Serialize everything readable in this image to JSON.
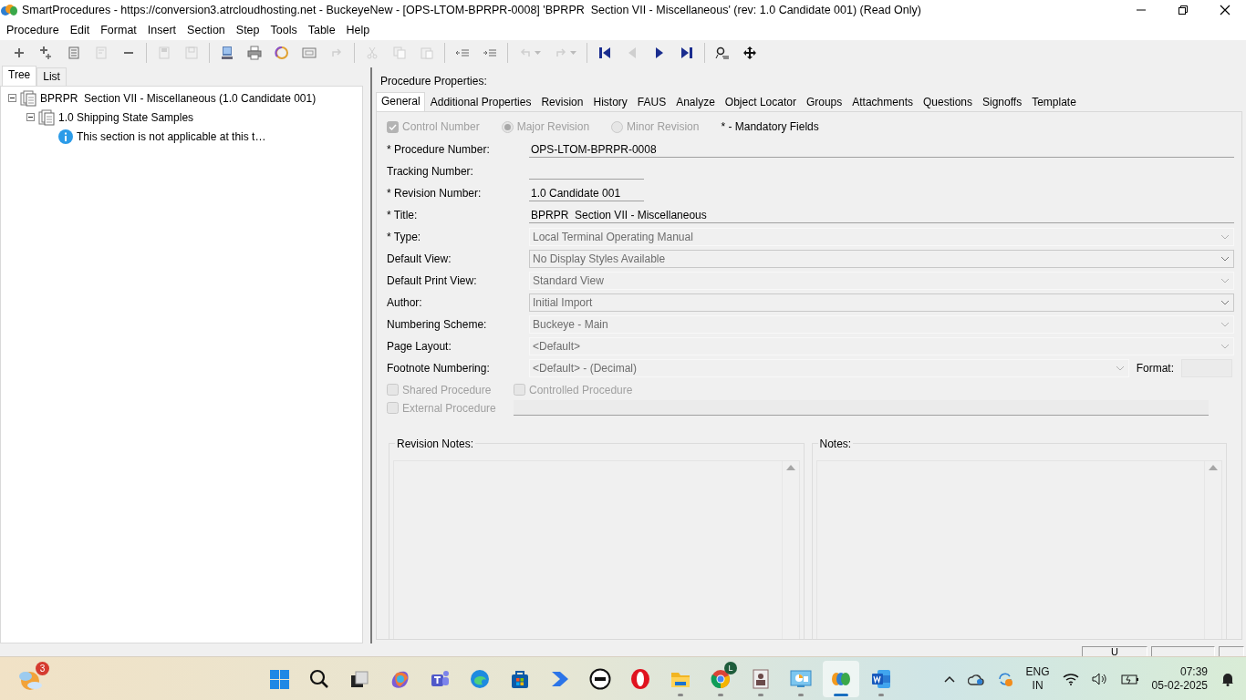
{
  "window": {
    "title": "SmartProcedures - https://conversion3.atrcloudhosting.net - BuckeyeNew - [OPS-LTOM-BPRPR-0008] 'BPRPR  Section VII - Miscellaneous' (rev: 1.0 Candidate 001) (Read Only)"
  },
  "menu": [
    "Procedure",
    "Edit",
    "Format",
    "Insert",
    "Section",
    "Step",
    "Tools",
    "Table",
    "Help"
  ],
  "toolbar": [
    {
      "kind": "button",
      "disabled": false
    },
    {
      "kind": "button",
      "disabled": false
    },
    {
      "kind": "button",
      "disabled": false
    },
    {
      "kind": "button",
      "disabled": true
    },
    {
      "kind": "button",
      "disabled": false
    },
    {
      "kind": "separator"
    },
    {
      "kind": "button",
      "disabled": true
    },
    {
      "kind": "button",
      "disabled": true
    },
    {
      "kind": "separator"
    },
    {
      "kind": "button",
      "disabled": false
    },
    {
      "kind": "button",
      "disabled": false
    },
    {
      "kind": "button",
      "disabled": false
    },
    {
      "kind": "button",
      "disabled": false
    },
    {
      "kind": "button",
      "disabled": true
    },
    {
      "kind": "separator"
    },
    {
      "kind": "button",
      "disabled": true
    },
    {
      "kind": "button",
      "disabled": true
    },
    {
      "kind": "button",
      "disabled": true
    },
    {
      "kind": "separator"
    },
    {
      "kind": "button",
      "disabled": false
    },
    {
      "kind": "button",
      "disabled": false
    },
    {
      "kind": "separator"
    },
    {
      "kind": "split-button",
      "disabled": true
    },
    {
      "kind": "split-button",
      "disabled": true
    },
    {
      "kind": "separator"
    },
    {
      "kind": "button",
      "disabled": false
    },
    {
      "kind": "button",
      "disabled": true
    },
    {
      "kind": "button",
      "disabled": false
    },
    {
      "kind": "button",
      "disabled": false
    },
    {
      "kind": "separator"
    },
    {
      "kind": "button",
      "disabled": false
    },
    {
      "kind": "button",
      "disabled": false
    }
  ],
  "left_tabs": [
    {
      "label": "Tree",
      "selected": true
    },
    {
      "label": "List",
      "selected": false
    }
  ],
  "tree": [
    {
      "label": "BPRPR  Section VII - Miscellaneous (1.0 Candidate 001)",
      "kind": "document",
      "expanded": true,
      "children": [
        {
          "label": "1.0 Shipping State Samples",
          "kind": "document",
          "expanded": true,
          "children": [
            {
              "label": "This section is not applicable at this t…",
              "kind": "info"
            }
          ]
        }
      ]
    }
  ],
  "properties": {
    "heading": "Procedure Properties:",
    "tabs": [
      {
        "label": "General",
        "selected": true
      },
      {
        "label": "Additional Properties",
        "selected": false
      },
      {
        "label": "Revision",
        "selected": false
      },
      {
        "label": "History",
        "selected": false
      },
      {
        "label": "FAUS",
        "selected": false
      },
      {
        "label": "Analyze",
        "selected": false
      },
      {
        "label": "Object Locator",
        "selected": false
      },
      {
        "label": "Groups",
        "selected": false
      },
      {
        "label": "Attachments",
        "selected": false
      },
      {
        "label": "Questions",
        "selected": false
      },
      {
        "label": "Signoffs",
        "selected": false
      },
      {
        "label": "Template",
        "selected": false
      }
    ],
    "options": [
      {
        "kind": "checkbox",
        "label": "Control Number",
        "checked": true,
        "disabled": true
      },
      {
        "kind": "radio",
        "label": "Major Revision",
        "selected": true,
        "disabled": true
      },
      {
        "kind": "radio",
        "label": "Minor Revision",
        "selected": false,
        "disabled": true
      }
    ],
    "mandatory_note": "* - Mandatory Fields",
    "fields": [
      {
        "label": "* Procedure Number:",
        "kind": "text",
        "value": "OPS-LTOM-BPRPR-0008"
      },
      {
        "label": "Tracking Number:",
        "kind": "short-text"
      },
      {
        "label": "* Revision Number:",
        "kind": "short-text",
        "value": "1.0 Candidate 001"
      },
      {
        "label": "* Title:",
        "kind": "text",
        "value": "BPRPR  Section VII - Miscellaneous"
      },
      {
        "label": "* Type:",
        "kind": "combo",
        "value": "Local Terminal Operating Manual",
        "disabled": true
      },
      {
        "label": "Default View:",
        "kind": "combo",
        "value": "No Display Styles Available",
        "disabled": false
      },
      {
        "label": "Default Print View:",
        "kind": "combo",
        "value": "Standard View",
        "disabled": true
      },
      {
        "label": "Author:",
        "kind": "combo",
        "value": "Initial Import",
        "disabled": false
      },
      {
        "label": "Numbering Scheme:",
        "kind": "combo",
        "value": "Buckeye - Main",
        "disabled": true
      },
      {
        "label": "Page Layout:",
        "kind": "combo",
        "value": "<Default>",
        "disabled": true
      },
      {
        "label": "Footnote Numbering:",
        "kind": "combo",
        "value": "<Default> - (Decimal)",
        "disabled": true,
        "format_label": "Format:"
      }
    ],
    "checkboxes": [
      {
        "kind": "checkbox",
        "label": "Shared Procedure",
        "checked": false,
        "disabled": true
      },
      {
        "kind": "checkbox",
        "label": "Controlled Procedure",
        "checked": false,
        "disabled": true
      },
      {
        "kind": "checkbox-field",
        "label": "External Procedure",
        "checked": false,
        "disabled": true
      }
    ],
    "notes_panels": [
      {
        "label": "Revision Notes:"
      },
      {
        "label": "Notes:"
      }
    ]
  },
  "status_bar": {
    "panel_1": "U"
  },
  "taskbar": {
    "weather_badge": "3",
    "apps": [
      {
        "running": false,
        "selected": false
      },
      {
        "running": false,
        "selected": false
      },
      {
        "running": false,
        "selected": false
      },
      {
        "running": false,
        "selected": false
      },
      {
        "running": false,
        "selected": false
      },
      {
        "running": false,
        "selected": false
      },
      {
        "running": false,
        "selected": false
      },
      {
        "running": false,
        "selected": false
      },
      {
        "running": false,
        "selected": false
      },
      {
        "running": false,
        "selected": false
      },
      {
        "running": true,
        "selected": false
      },
      {
        "running": true,
        "selected": false,
        "badge": "L"
      },
      {
        "running": true,
        "selected": false
      },
      {
        "running": true,
        "selected": false
      },
      {
        "running": true,
        "selected": true
      },
      {
        "running": true,
        "selected": false
      }
    ],
    "tray": {
      "language": "ENG",
      "region": "IN",
      "time": "07:39",
      "date": "05-02-2025"
    }
  }
}
